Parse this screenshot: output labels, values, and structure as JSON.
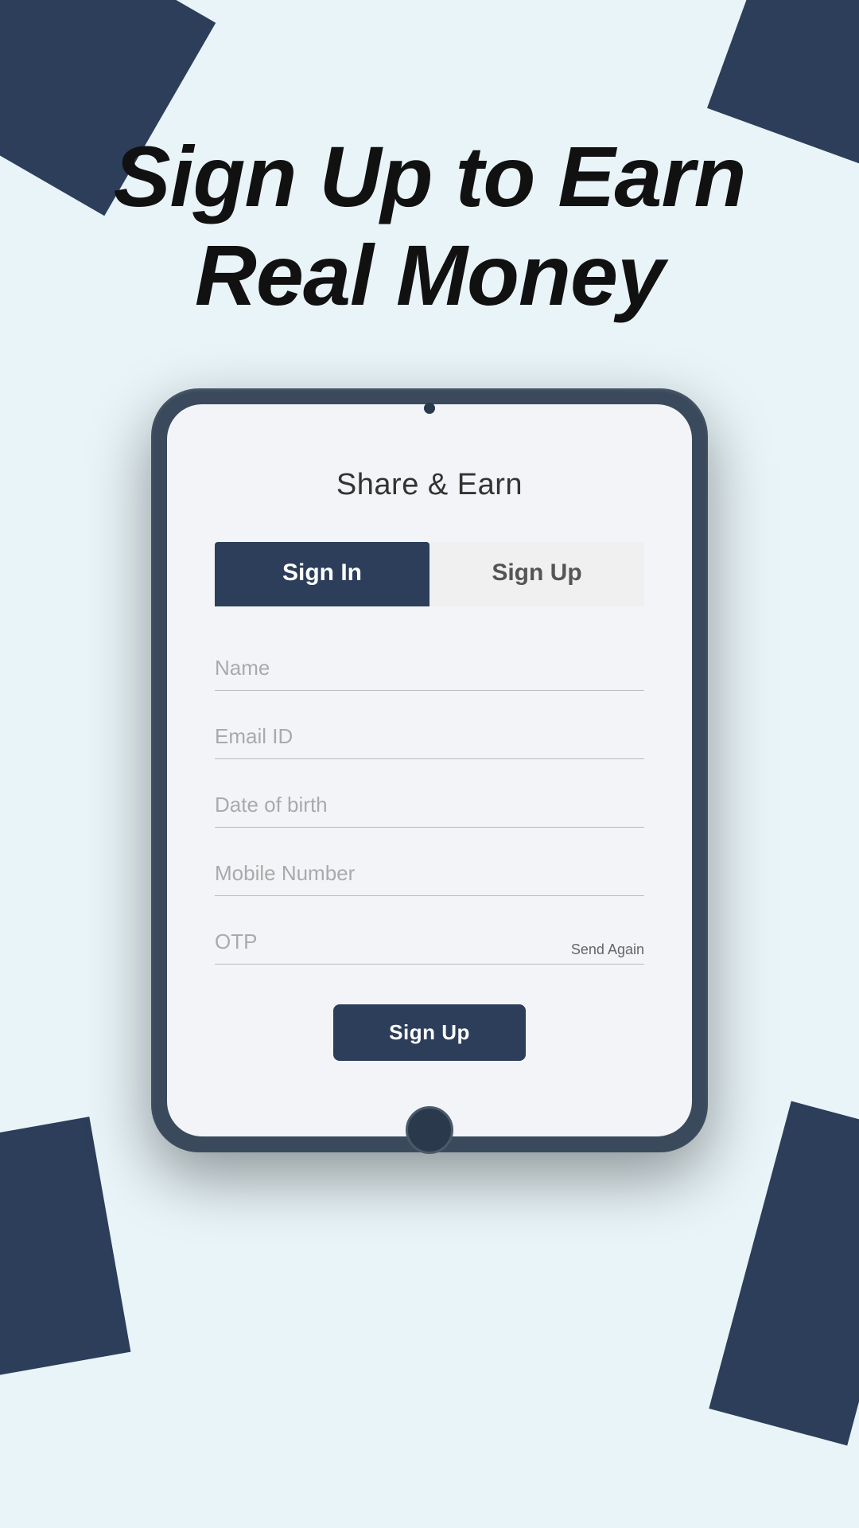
{
  "background": {
    "color": "#e8f4f8"
  },
  "hero": {
    "line1": "Sign Up to Earn",
    "line2": "Real Money"
  },
  "app": {
    "title": "Share & Earn",
    "tabs": [
      {
        "label": "Sign In",
        "active": true
      },
      {
        "label": "Sign Up",
        "active": false
      }
    ],
    "form": {
      "name_placeholder": "Name",
      "email_placeholder": "Email ID",
      "dob_placeholder": "Date of birth",
      "mobile_placeholder": "Mobile Number",
      "otp_placeholder": "OTP",
      "send_again_label": "Send Again",
      "signup_button_label": "Sign Up"
    }
  }
}
